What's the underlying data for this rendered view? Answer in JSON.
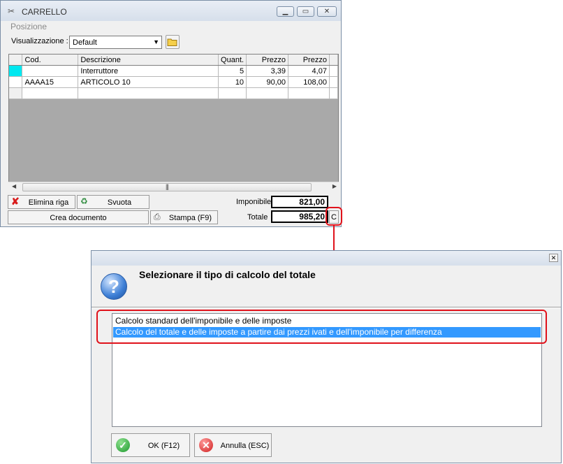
{
  "window_cart": {
    "title": "CARRELLO",
    "menu": [
      "Posizione"
    ],
    "view_label": "Visualizzazione :",
    "view_value": "Default",
    "grid": {
      "columns": [
        "Cod.",
        "Descrizione",
        "Quant.",
        "Prezzo",
        "Prezzo"
      ],
      "rows": [
        [
          "",
          "Interruttore",
          "5",
          "3,39",
          "4,07"
        ],
        [
          "AAAA15",
          "ARTICOLO 10",
          "10",
          "90,00",
          "108,00"
        ],
        [
          "",
          "",
          "",
          "",
          ""
        ]
      ]
    },
    "buttons": {
      "delete_row": "Elimina riga",
      "empty": "Svuota",
      "create_doc": "Crea documento",
      "print": "Stampa (F9)",
      "calc_mode": "C"
    },
    "taxable_label": "Imponibile",
    "taxable_value": "821,00",
    "total_label": "Totale",
    "total_value": "985,20"
  },
  "dialog": {
    "title": "Selezionare il tipo di calcolo del totale",
    "options": [
      "Calcolo standard dell'imponibile e delle imposte",
      "Calcolo del totale e delle imposte a partire dai prezzi ivati e dell'imponibile per differenza"
    ],
    "selected_index": 1,
    "ok_label": "OK (F12)",
    "cancel_label": "Annulla (ESC)"
  },
  "icons": {
    "help": "question-icon",
    "ok": "check-icon",
    "cancel": "x-icon",
    "delete": "red-x-icon",
    "empty": "recycle-bin-icon",
    "print": "printer-icon",
    "folder": "folder-icon"
  },
  "colors": {
    "highlight": "#e0121b",
    "selection": "#3399ff",
    "current_row_indicator": "#00e8f0"
  }
}
